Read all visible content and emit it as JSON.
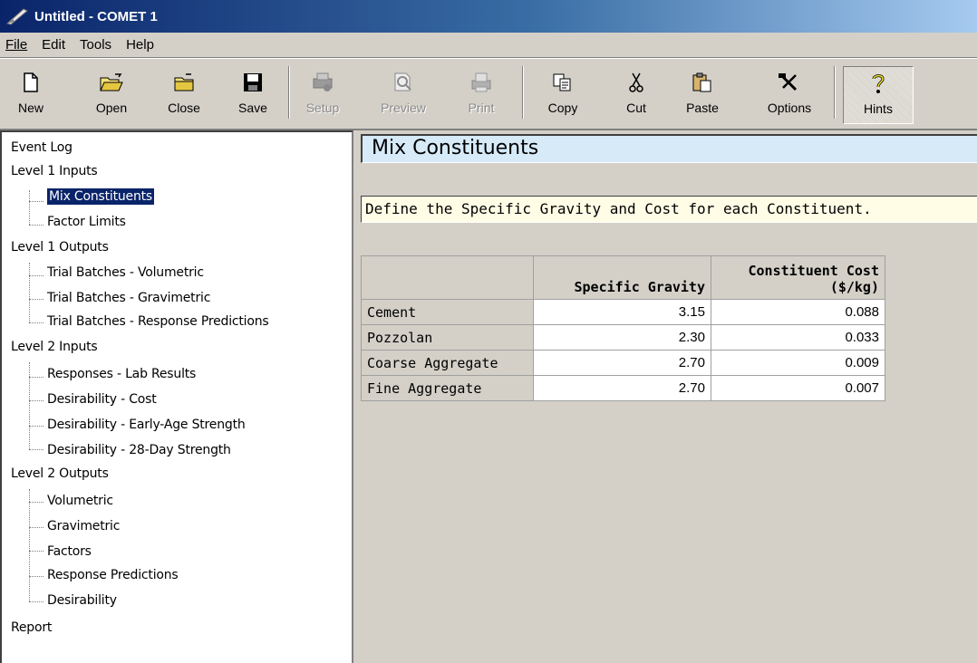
{
  "window": {
    "title": "Untitled - COMET 1"
  },
  "menu": [
    "File",
    "Edit",
    "Tools",
    "Help"
  ],
  "toolbar": {
    "new": "New",
    "open": "Open",
    "close": "Close",
    "save": "Save",
    "setup": "Setup",
    "preview": "Preview",
    "print": "Print",
    "copy": "Copy",
    "cut": "Cut",
    "paste": "Paste",
    "options": "Options",
    "hints": "Hints"
  },
  "tree": {
    "event_log": "Event Log",
    "level1_inputs": "Level 1 Inputs",
    "mix_constituents": "Mix Constituents",
    "factor_limits": "Factor Limits",
    "level1_outputs": "Level 1 Outputs",
    "trial_volumetric": "Trial Batches - Volumetric",
    "trial_gravimetric": "Trial Batches - Gravimetric",
    "trial_response": "Trial Batches - Response Predictions",
    "level2_inputs": "Level 2 Inputs",
    "responses_lab": "Responses - Lab Results",
    "desir_cost": "Desirability - Cost",
    "desir_early": "Desirability - Early-Age Strength",
    "desir_28": "Desirability - 28-Day Strength",
    "level2_outputs": "Level 2 Outputs",
    "volumetric": "Volumetric",
    "gravimetric": "Gravimetric",
    "factors": "Factors",
    "response_predictions": "Response Predictions",
    "desirability": "Desirability",
    "report": "Report"
  },
  "main": {
    "title": "Mix Constituents",
    "instructions": "Define the Specific Gravity and Cost for each Constituent.",
    "table": {
      "col1": "Specific Gravity",
      "col2_line1": "Constituent Cost",
      "col2_line2": "($/kg)",
      "rows": [
        {
          "name": "Cement",
          "sg": "3.15",
          "cost": "0.088"
        },
        {
          "name": "Pozzolan",
          "sg": "2.30",
          "cost": "0.033"
        },
        {
          "name": "Coarse Aggregate",
          "sg": "2.70",
          "cost": "0.009"
        },
        {
          "name": "Fine Aggregate",
          "sg": "2.70",
          "cost": "0.007"
        }
      ]
    }
  }
}
